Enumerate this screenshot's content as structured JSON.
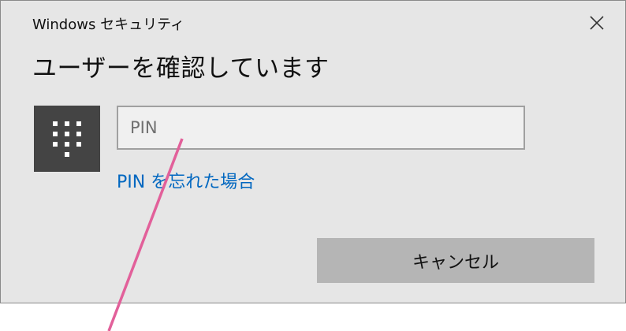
{
  "window": {
    "title": "Windows セキュリティ"
  },
  "dialog": {
    "heading": "ユーザーを確認しています",
    "pin_icon": "keypad-icon",
    "pin_input": {
      "placeholder": "PIN",
      "value": ""
    },
    "forgot_pin_link": "PIN を忘れた場合",
    "cancel_button": "キャンセル"
  },
  "icons": {
    "close": "close-icon",
    "pin": "keypad-icon"
  },
  "colors": {
    "dialog_background": "#e6e6e6",
    "pin_tile": "#444444",
    "link": "#0067c0",
    "cancel_button": "#b5b5b5",
    "annotation_line": "#e2609a"
  }
}
